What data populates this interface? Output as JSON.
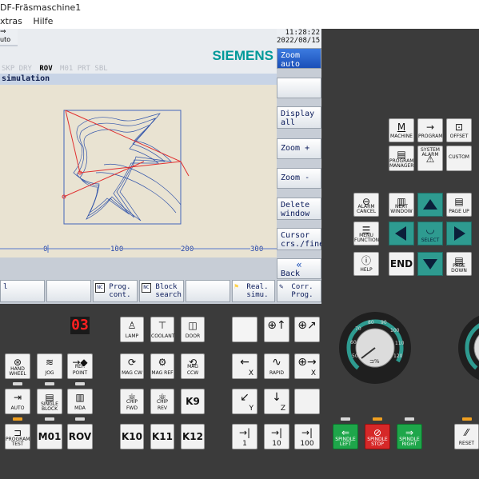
{
  "window": {
    "title": "DF-Fräsmaschine1",
    "menu": [
      "xtras",
      "Hilfe"
    ],
    "corner_label": "uto"
  },
  "hmi": {
    "time": "11:28:22",
    "date": "2022/08/15",
    "brand": "SIEMENS",
    "status_line": {
      "inactive1": "SKP DRY",
      "active": "ROV",
      "inactive2": "M01 PRT SBL"
    },
    "panel_title": "simulation",
    "axis_ticks": [
      "0",
      "100",
      "200",
      "300"
    ],
    "vertical_softkeys": [
      "Zoom\nauto",
      "",
      "Display\nall",
      "Zoom +",
      "Zoom -",
      "Delete\nwindow",
      "Cursor\ncrs./fine",
      "Back"
    ],
    "horizontal_softkeys": [
      "l",
      "",
      "",
      "Prog.\ncont.",
      "Block\nsearch",
      "",
      "Real.\nsimu.",
      "Corr.\nProg."
    ]
  },
  "keyboard": {
    "top_row": [
      {
        "sym": "M",
        "label": "MACHINE"
      },
      {
        "sym": "→",
        "label": "PROGRAM"
      },
      {
        "sym": "⊡",
        "label": "OFFSET"
      }
    ],
    "second_row": [
      {
        "sym": "▤",
        "label": "PROGRAM MANAGER"
      },
      {
        "sym": "⚠",
        "label": "SYSTEM ALARM"
      },
      {
        "sym": "",
        "label": "CUSTOM"
      }
    ],
    "left_keys": [
      {
        "sym": "⊖",
        "label": "ALARM CANCEL"
      },
      {
        "sym": "▥",
        "label": "NEXT WINDOW"
      },
      {
        "sym": "☰",
        "label": "MENU FUNCTION"
      },
      {
        "sym": "ⓘ",
        "label": "HELP"
      },
      {
        "sym": "",
        "label": "END"
      }
    ],
    "nav": {
      "select": "SELECT",
      "page_up": "PAGE UP",
      "page_down": "PAGE DOWN"
    }
  },
  "machine_panel": {
    "tool_display": "03",
    "keys": [
      {
        "name": "lamp",
        "label": "LAMP"
      },
      {
        "name": "coolant",
        "label": "COOLANT"
      },
      {
        "name": "door",
        "label": "DOOR"
      },
      {
        "name": "hand-wheel",
        "label": "HAND WHEEL"
      },
      {
        "name": "jog",
        "label": "JOG"
      },
      {
        "name": "ref-point",
        "label": "REF. POINT"
      },
      {
        "name": "mag-cw",
        "label": "MAG CW"
      },
      {
        "name": "mag-ref",
        "label": "MAG REF"
      },
      {
        "name": "mag-ccw",
        "label": "MAG CCW"
      },
      {
        "name": "auto",
        "label": "AUTO"
      },
      {
        "name": "single-block",
        "label": "SINGLE BLOCK"
      },
      {
        "name": "mda",
        "label": "MDA"
      },
      {
        "name": "chip-fwd",
        "label": "CHIP FWD"
      },
      {
        "name": "chip-rev",
        "label": "CHIP REV"
      },
      {
        "name": "k9",
        "label": "K9"
      },
      {
        "name": "program-test",
        "label": "PROGRAM TEST"
      },
      {
        "name": "m01",
        "label": "M01"
      },
      {
        "name": "rov",
        "label": "ROV"
      },
      {
        "name": "k10",
        "label": "K10"
      },
      {
        "name": "k11",
        "label": "K11"
      },
      {
        "name": "k12",
        "label": "K12"
      },
      {
        "name": "rapid",
        "label": "RAPID"
      },
      {
        "name": "x-plus",
        "label": "X"
      },
      {
        "name": "x-minus",
        "label": "X"
      },
      {
        "name": "z-plus",
        "label": "Z"
      },
      {
        "name": "z-minus",
        "label": "Z"
      },
      {
        "name": "y-plus",
        "label": "Y"
      },
      {
        "name": "y-minus",
        "label": "Y"
      },
      {
        "name": "inc-1",
        "label": "1"
      },
      {
        "name": "inc-10",
        "label": "10"
      },
      {
        "name": "inc-100",
        "label": "100"
      },
      {
        "name": "spindle-left",
        "label": "SPINDLE LEFT"
      },
      {
        "name": "spindle-stop",
        "label": "SPINDLE STOP"
      },
      {
        "name": "spindle-right",
        "label": "SPINDLE RIGHT"
      },
      {
        "name": "reset",
        "label": "RESET"
      }
    ],
    "feed_override": {
      "ticks": [
        "60",
        "70",
        "80",
        "90",
        "100",
        "110",
        "120",
        "50"
      ],
      "unit": "%"
    }
  },
  "colors": {
    "accent_blue": "#1a4fb8",
    "teal": "#2e9b90",
    "spindle_green": "#1ea64a",
    "spindle_red": "#d62828",
    "siemens": "#009999"
  }
}
